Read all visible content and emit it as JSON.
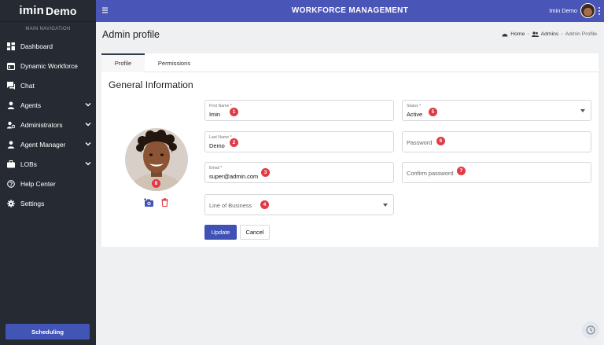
{
  "brand": {
    "logo_mark": "imin",
    "logo_text": "Demo"
  },
  "sidebar": {
    "heading": "MAIN NAVIGATION",
    "items": [
      {
        "label": "Dashboard",
        "icon": "dashboard-icon"
      },
      {
        "label": "Dynamic Workforce",
        "icon": "calendar-icon"
      },
      {
        "label": "Chat",
        "icon": "chat-icon"
      },
      {
        "label": "Agents",
        "icon": "person-icon",
        "expandable": true
      },
      {
        "label": "Administrators",
        "icon": "admin-icon",
        "expandable": true
      },
      {
        "label": "Agent Manager",
        "icon": "person-icon",
        "expandable": true
      },
      {
        "label": "LOBs",
        "icon": "briefcase-icon",
        "expandable": true
      },
      {
        "label": "Help Center",
        "icon": "help-icon"
      },
      {
        "label": "Settings",
        "icon": "gear-icon"
      }
    ],
    "scheduling_label": "Scheduling"
  },
  "topbar": {
    "title": "WORKFORCE MANAGEMENT",
    "user_name": "Imin Demo"
  },
  "page": {
    "title": "Admin profile",
    "breadcrumb": {
      "home": "Home",
      "admins": "Admins",
      "current": "Admin Profile"
    }
  },
  "tabs": [
    {
      "label": "Profile",
      "active": true
    },
    {
      "label": "Permissions",
      "active": false
    }
  ],
  "form": {
    "section_title": "General Information",
    "first_name": {
      "label": "First Name *",
      "value": "Imin",
      "badge": "1"
    },
    "last_name": {
      "label": "Last Name *",
      "value": "Demo",
      "badge": "2"
    },
    "email": {
      "label": "Email *",
      "value": "super@admin.com",
      "badge": "3"
    },
    "line_of_business": {
      "placeholder": "Line of Business",
      "badge": "4"
    },
    "status": {
      "label": "Status *",
      "value": "Active",
      "badge": "5"
    },
    "password": {
      "placeholder": "Password",
      "badge": "6"
    },
    "confirm_password": {
      "placeholder": "Confirm password",
      "badge": "7"
    },
    "avatar_badge": "8",
    "update_label": "Update",
    "cancel_label": "Cancel"
  },
  "colors": {
    "sidebar_bg": "#262b33",
    "topbar_bg": "#4a55b8",
    "accent": "#3f51b5",
    "badge": "#e03a45",
    "delete": "#e03a45"
  }
}
